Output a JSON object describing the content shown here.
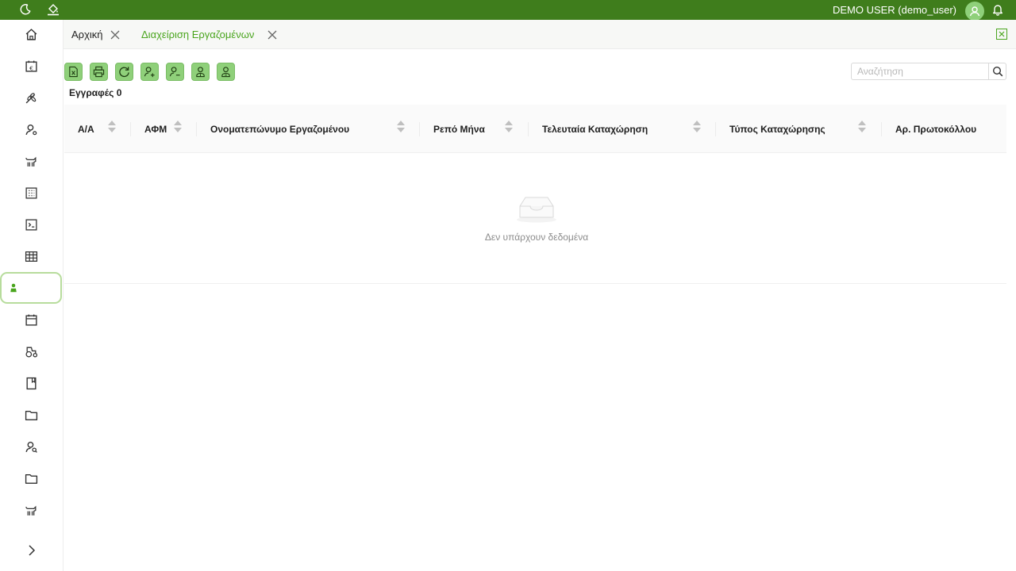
{
  "topbar": {
    "user": "DEMO USER (demo_user)",
    "icons": [
      "moon-icon",
      "paint-bucket-icon",
      "user-icon",
      "bell-icon"
    ],
    "bg_color": "#3f7d1c",
    "avatar_color": "#8fd07a"
  },
  "sidebar": {
    "items": [
      {
        "icon": "home-icon"
      },
      {
        "icon": "calendar-euro-icon"
      },
      {
        "icon": "wheat-icon"
      },
      {
        "icon": "user-settings-icon"
      },
      {
        "icon": "livestock-icon"
      },
      {
        "icon": "building-icon"
      },
      {
        "icon": "terminal-icon"
      },
      {
        "icon": "grid-table-icon"
      },
      {
        "icon": "worker-icon",
        "active": true
      },
      {
        "icon": "calendar-icon"
      },
      {
        "icon": "tractor-icon"
      },
      {
        "icon": "book-icon"
      },
      {
        "icon": "folder-icon"
      },
      {
        "icon": "user-search-icon"
      },
      {
        "icon": "folder-icon"
      },
      {
        "icon": "livestock-icon"
      }
    ],
    "collapse_icon": "chevron-right-icon",
    "active_border_color": "#b7dc9c"
  },
  "tabs": [
    {
      "label": "Αρχική"
    },
    {
      "label": "Διαχείριση Εργαζομένων",
      "active": true
    }
  ],
  "accent_color": "#4aa51e",
  "toolbar": {
    "buttons": [
      "export-excel-icon",
      "print-icon",
      "refresh-icon",
      "add-user-icon",
      "remove-user-icon",
      "user-up-icon",
      "user-minus-icon"
    ],
    "button_color": "#8fd07a"
  },
  "search": {
    "placeholder": "Αναζήτηση",
    "value": ""
  },
  "records_label": "Εγγραφές 0",
  "table": {
    "columns": [
      "Α/Α",
      "ΑΦΜ",
      "Ονοματεπώνυμο Εργαζομένου",
      "Ρεπό Μήνα",
      "Τελευταία Καταχώρηση",
      "Τύπος Καταχώρησης",
      "Αρ. Πρωτοκόλλου"
    ],
    "rows": [],
    "empty_text": "Δεν υπάρχουν δεδομένα"
  }
}
